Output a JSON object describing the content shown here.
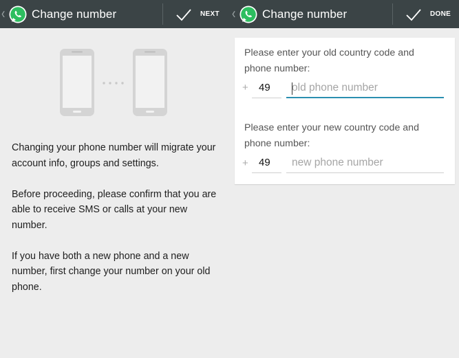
{
  "left_screen": {
    "actionbar": {
      "up_glyph": "‹",
      "title": "Change number",
      "action_label": "NEXT"
    },
    "paragraphs": [
      "Changing your phone number will migrate your account info, groups and settings.",
      "Before proceeding, please confirm that you are able to receive SMS or calls at your new number.",
      "If you have both a new phone and a new number, first change your number on your old phone."
    ]
  },
  "right_screen": {
    "actionbar": {
      "up_glyph": "‹",
      "title": "Change number",
      "action_label": "DONE"
    },
    "old": {
      "prompt": "Please enter your old country code and phone number:",
      "plus": "+",
      "country_code": "49",
      "phone_placeholder": "old phone number"
    },
    "new": {
      "prompt": "Please enter your new country code and phone number:",
      "plus": "+",
      "country_code": "49",
      "phone_placeholder": "new phone number"
    }
  },
  "colors": {
    "actionbar": "#3b4446",
    "whatsapp_green": "#25d366",
    "focus_underline": "#2a8fb0",
    "background": "#ededed"
  },
  "icons": [
    "whatsapp-logo-icon",
    "checkmark-icon",
    "phone-icon",
    "dots-icon",
    "up-chevron-icon"
  ]
}
